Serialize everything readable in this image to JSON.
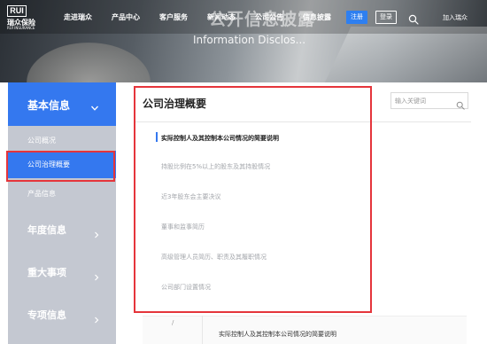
{
  "logo": {
    "mark": "RUI",
    "name_cn": "瑞众保险",
    "name_en": "RUI INSURANCE"
  },
  "nav": {
    "items": [
      "走进瑞众",
      "产品中心",
      "客户服务",
      "新闻动态",
      "公司公告",
      "信息披露"
    ],
    "register_label": "注册",
    "login_label": "登录",
    "join_label": "加入瑞众"
  },
  "hero": {
    "title": "公开信息披露",
    "subtitle": "Information Disclos..."
  },
  "sidebar": {
    "head": "基本信息",
    "sub_items": [
      "公司概况",
      "公司治理概要",
      "产品信息"
    ],
    "active_sub": "公司治理概要",
    "sections": [
      "年度信息",
      "重大事项",
      "专项信息"
    ]
  },
  "main": {
    "title": "公司治理概要",
    "search_placeholder": "输入关键词",
    "list": [
      "实际控制人及其控制本公司情况的简要说明",
      "持股比例在5%以上的股东及其持股情况",
      "近3年股东会主要决议",
      "董事和监事简历",
      "高级管理人员简历、职责及其履职情况",
      "公司部门设置情况"
    ],
    "active_index": 0
  },
  "bottom": {
    "tick": "/",
    "text": "实际控制人及其控制本公司情况的简要说明"
  },
  "colors": {
    "accent": "#3478ef",
    "sidebar_bg": "#c4c8d1",
    "highlight": "#e5353b",
    "muted_text": "#a3a6ab"
  }
}
